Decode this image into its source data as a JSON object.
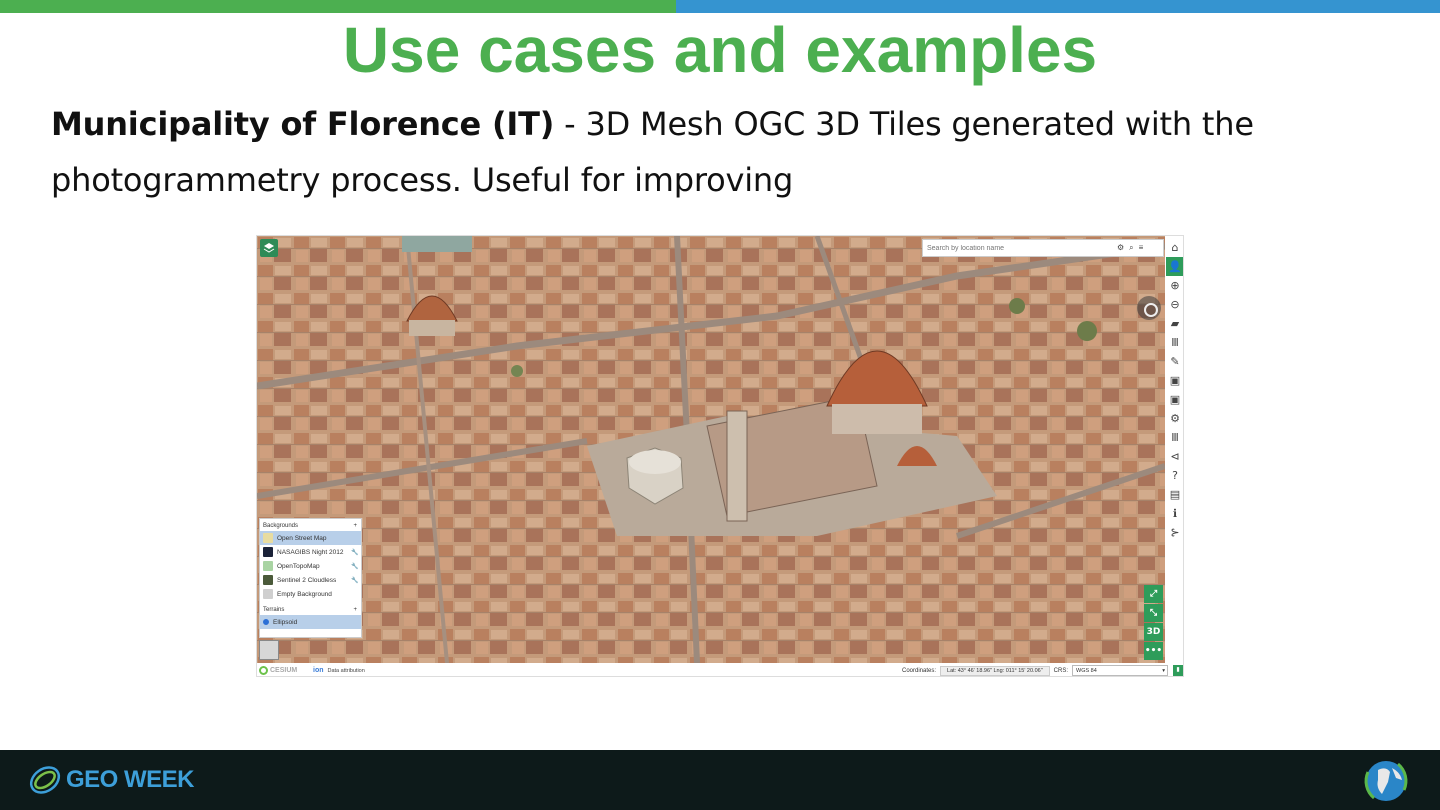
{
  "slide": {
    "title": "Use cases and examples",
    "body_bold": "Municipality of Florence (IT)",
    "body_rest": " - 3D Mesh OGC 3D Tiles  generated with the photogrammetry process. Useful for improving"
  },
  "viewer": {
    "search_placeholder": "Search by location name",
    "right_toolbar": [
      {
        "icon": "home-icon",
        "glyph": "⌂"
      },
      {
        "icon": "user-icon",
        "glyph": "👤"
      },
      {
        "icon": "upload-icon",
        "glyph": "⊕"
      },
      {
        "icon": "download-icon",
        "glyph": "⊖"
      },
      {
        "icon": "folder-icon",
        "glyph": "▰"
      },
      {
        "icon": "library-icon",
        "glyph": "Ⅲ"
      },
      {
        "icon": "pencil-icon",
        "glyph": "✎"
      },
      {
        "icon": "save-icon",
        "glyph": "▣"
      },
      {
        "icon": "save-as-icon",
        "glyph": "▣"
      },
      {
        "icon": "gear-icon",
        "glyph": "⚙"
      },
      {
        "icon": "map-catalog-icon",
        "glyph": "Ⅲ"
      },
      {
        "icon": "share-icon",
        "glyph": "⊲"
      },
      {
        "icon": "help-icon",
        "glyph": "?"
      },
      {
        "icon": "book-icon",
        "glyph": "▤"
      },
      {
        "icon": "info-icon",
        "glyph": "ℹ"
      },
      {
        "icon": "network-icon",
        "glyph": "⊱"
      }
    ],
    "map_controls": {
      "fullscreen": "⤢",
      "zoom_extent": "⤡",
      "mode_3d": "3D",
      "more": "•••"
    },
    "backgrounds": {
      "header": "Backgrounds",
      "add": "+",
      "items": [
        {
          "label": "Open Street Map",
          "color": "#e8dca0",
          "active": true,
          "wrench": ""
        },
        {
          "label": "NASAGIBS Night 2012",
          "color": "#1a2238",
          "active": false,
          "wrench": "🔧"
        },
        {
          "label": "OpenTopoMap",
          "color": "#a9d4a3",
          "active": false,
          "wrench": "🔧"
        },
        {
          "label": "Sentinel 2 Cloudless",
          "color": "#4b5a3a",
          "active": false,
          "wrench": "🔧"
        },
        {
          "label": "Empty Background",
          "color": "#cfcfcf",
          "active": false,
          "wrench": ""
        }
      ]
    },
    "terrains": {
      "header": "Terrains",
      "add": "+",
      "selected": "Ellipsoid"
    },
    "bottom": {
      "cesium": "CESIUM",
      "ion": "ion",
      "data_attribution": "Data attribution",
      "coordinates_label": "Coordinates:",
      "coordinates_value": "Lat: 43° 46' 18.96\" Lng: 011° 15' 20.06\"",
      "crs_label": "CRS:",
      "crs_value": "WGS 84"
    }
  },
  "footer": {
    "brand": "GEO WEEK"
  },
  "colors": {
    "title_green": "#4caf50",
    "bar_blue": "#3594d0",
    "viewer_green": "#2e9c5a",
    "footer_bg": "#0d1a1a"
  }
}
